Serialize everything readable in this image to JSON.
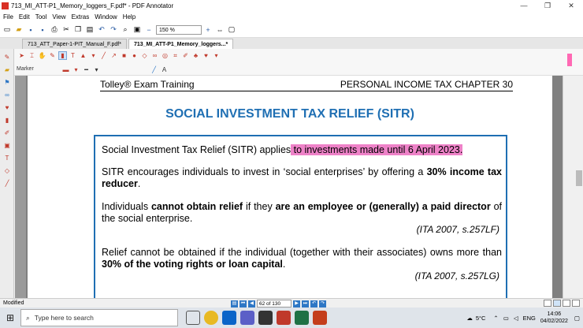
{
  "window": {
    "title": "713_MI_ATT-P1_Memory_loggers_F.pdf* - PDF Annotator",
    "minimize": "—",
    "maximize": "❐",
    "close": "✕"
  },
  "menu": [
    "File",
    "Edit",
    "Tool",
    "View",
    "Extras",
    "Window",
    "Help"
  ],
  "toolbar": {
    "zoom": "150 %"
  },
  "tabs": [
    {
      "label": "713_ATT_Paper-1-PIT_Manual_F.pdf*"
    },
    {
      "label": "713_MI_ATT-P1_Memory_loggers...*"
    }
  ],
  "tool_label": "Marker",
  "document": {
    "header_left": "Tolley® Exam Training",
    "header_right": "PERSONAL INCOME TAX  CHAPTER  30",
    "title": "SOCIAL INVESTMENT TAX RELIEF (SITR)",
    "p1_a": "Social Investment Tax Relief (SITR) applies",
    "p1_b": " to investments made until 6 April 2023.",
    "p2_a": "SITR encourages individuals to invest in ‘social enterprises’ by offering a ",
    "p2_b": "30% income tax reducer",
    "p2_c": ".",
    "p3_a": "Individuals ",
    "p3_b": "cannot obtain relief",
    "p3_c": " if they ",
    "p3_d": "are an employee or (generally) a paid director",
    "p3_e": " of the social enterprise.",
    "ref1": "(ITA 2007, s.257LF)",
    "p4_a": "Relief cannot be obtained if the individual (together with their associates) owns more than ",
    "p4_b": "30% of the voting rights or loan capital",
    "p4_c": ".",
    "ref2": "(ITA 2007, s.257LG)"
  },
  "status": {
    "left": "Modified",
    "page": "62 of 130"
  },
  "taskbar": {
    "search_placeholder": "Type here to search",
    "temperature": "5°C",
    "language": "ENG",
    "time": "14:06",
    "date": "04/02/2022"
  },
  "colors": {
    "highlight": "#ee82c8",
    "title_blue": "#1f6fb3",
    "border_blue": "#1f6fb3"
  }
}
